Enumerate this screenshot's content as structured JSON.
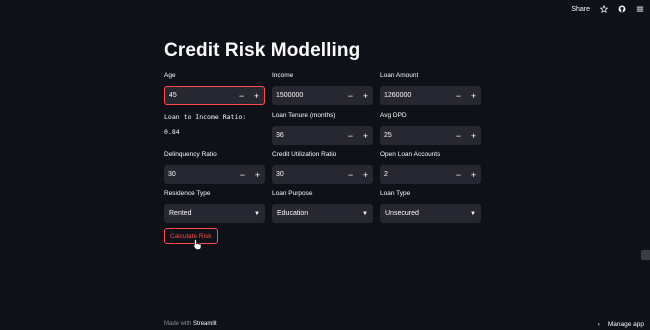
{
  "topbar": {
    "share_label": "Share"
  },
  "title": "Credit Risk Modelling",
  "fields": {
    "age": {
      "label": "Age",
      "value": "45"
    },
    "income": {
      "label": "Income",
      "value": "1500000"
    },
    "loan_amount": {
      "label": "Loan Amount",
      "value": "1260000"
    },
    "loan_tenure": {
      "label": "Loan Tenure (months)",
      "value": "36"
    },
    "avg_dpd": {
      "label": "Avg DPD",
      "value": "25"
    },
    "delinquency_ratio": {
      "label": "Delinquency Ratio",
      "value": "30"
    },
    "credit_utilization": {
      "label": "Credit Utilization Ratio",
      "value": "30"
    },
    "open_loan_accounts": {
      "label": "Open Loan Accounts",
      "value": "2"
    }
  },
  "ratio": {
    "label": "Loan to Income Ratio:",
    "value": "0.84"
  },
  "selects": {
    "residence_type": {
      "label": "Residence Type",
      "value": "Rented"
    },
    "loan_purpose": {
      "label": "Loan Purpose",
      "value": "Education"
    },
    "loan_type": {
      "label": "Loan Type",
      "value": "Unsecured"
    }
  },
  "stepper": {
    "minus": "−",
    "plus": "+"
  },
  "calculate_button": "Calculate Risk",
  "footer": {
    "made_with": "Made with",
    "brand": "Streamlit"
  },
  "manage_app": "Manage app",
  "colors": {
    "background": "#0e1117",
    "input_bg": "#262730",
    "accent": "#ff4b4b"
  }
}
